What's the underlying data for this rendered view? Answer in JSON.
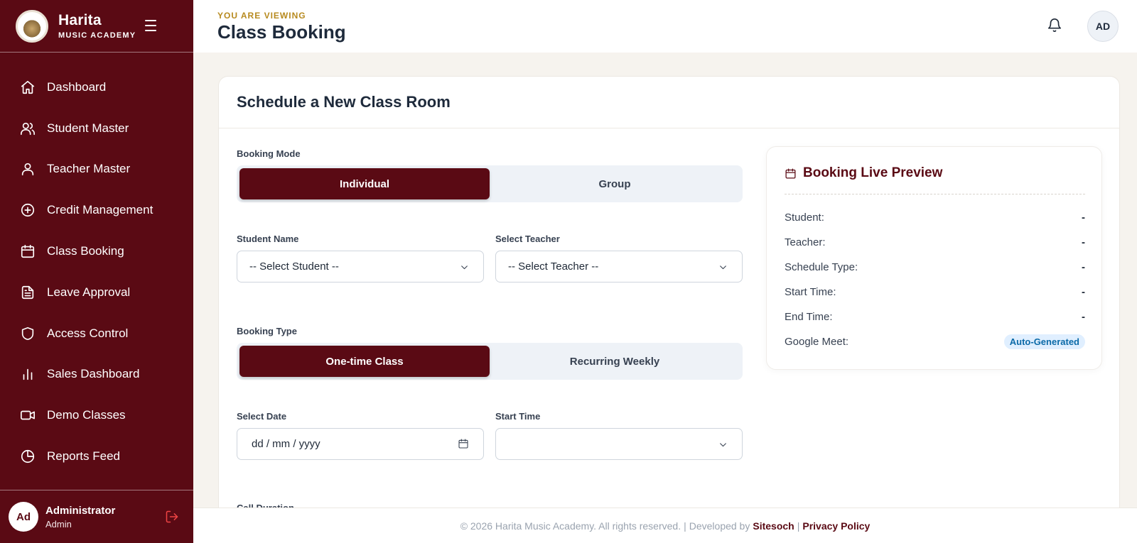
{
  "brand": {
    "name": "Harita",
    "subtitle": "MUSIC ACADEMY"
  },
  "sidebar": {
    "items": [
      {
        "label": "Dashboard",
        "icon": "home-icon"
      },
      {
        "label": "Student Master",
        "icon": "users-icon"
      },
      {
        "label": "Teacher Master",
        "icon": "user-icon"
      },
      {
        "label": "Credit Management",
        "icon": "plus-circle-icon"
      },
      {
        "label": "Class Booking",
        "icon": "calendar-icon"
      },
      {
        "label": "Leave Approval",
        "icon": "file-text-icon"
      },
      {
        "label": "Access Control",
        "icon": "shield-icon"
      },
      {
        "label": "Sales Dashboard",
        "icon": "bar-chart-icon"
      },
      {
        "label": "Demo Classes",
        "icon": "video-icon"
      },
      {
        "label": "Reports Feed",
        "icon": "pie-chart-icon"
      }
    ],
    "user": {
      "initials": "Ad",
      "name": "Administrator",
      "role": "Admin"
    }
  },
  "header": {
    "eyebrow": "YOU ARE VIEWING",
    "title": "Class Booking",
    "avatar_initials": "AD"
  },
  "form": {
    "title": "Schedule a New Class Room",
    "booking_mode": {
      "label": "Booking Mode",
      "options": [
        "Individual",
        "Group"
      ],
      "selected": "Individual"
    },
    "student": {
      "label": "Student Name",
      "value": "-- Select Student --"
    },
    "teacher": {
      "label": "Select Teacher",
      "value": "-- Select Teacher --"
    },
    "booking_type": {
      "label": "Booking Type",
      "options": [
        "One-time Class",
        "Recurring Weekly"
      ],
      "selected": "One-time Class"
    },
    "date": {
      "label": "Select Date",
      "placeholder": "dd / mm / yyyy"
    },
    "start_time": {
      "label": "Start Time",
      "value": ""
    },
    "call_duration": {
      "label": "Call Duration"
    }
  },
  "preview": {
    "title": "Booking Live Preview",
    "rows": [
      {
        "label": "Student:",
        "value": "-"
      },
      {
        "label": "Teacher:",
        "value": "-"
      },
      {
        "label": "Schedule Type:",
        "value": "-"
      },
      {
        "label": "Start Time:",
        "value": "-"
      },
      {
        "label": "End Time:",
        "value": "-"
      }
    ],
    "meet": {
      "label": "Google Meet:",
      "value": "Auto-Generated"
    }
  },
  "footer": {
    "copyright": "© 2026 Harita Music Academy. All rights reserved.",
    "separator": "|",
    "developed_by": "Developed by",
    "developer": "Sitesoch",
    "privacy": "Privacy Policy"
  },
  "colors": {
    "brand": "#5a0a14",
    "accent": "#b78a1f",
    "badge_bg": "#e0efff",
    "badge_text": "#0b6aa8"
  }
}
